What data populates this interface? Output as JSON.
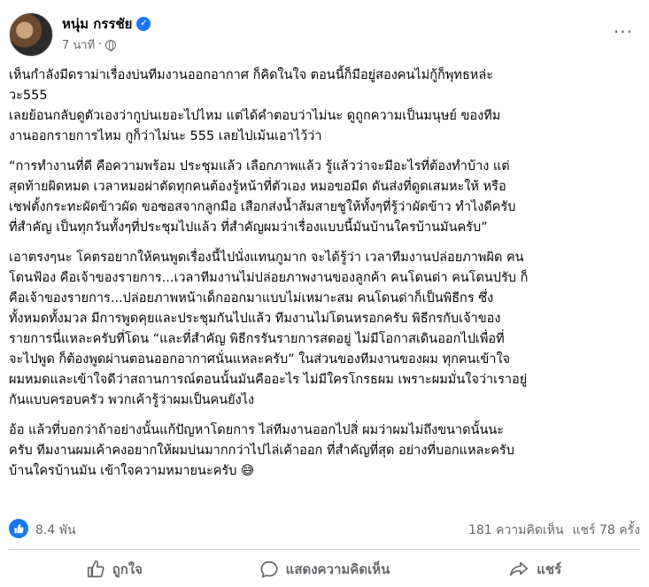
{
  "author": {
    "name": "หนุ่ม กรรชัย",
    "time": "7 นาที",
    "separator": "·"
  },
  "menu": {
    "more_label": "···"
  },
  "content": {
    "p1": [
      "เห็นกำลังมีดราม่าเรื่องบ่นทีมงานออกอากาศ ก็คิดในใจ ตอนนี้ก็มีอยู่สองคนไม่กู้ก็พุทธหล่ะ",
      "วะ555"
    ],
    "p2": [
      "เลยย้อนกลับดูตัวเองว่ากูบ่นเยอะไปไหม แต่ได้คำตอบว่าไม่นะ ดูถูกความเป็นมนุษย์ ของทีม",
      "งานออกรายการไหม กูก็ว่าไม่นะ 555 เลยไปเม้นเอาไว้ว่า"
    ],
    "p3": [
      "“การทำงานที่ดี คือความพร้อม ประชุมแล้ว เลือกภาพแล้ว รู้แล้วว่าจะมีอะไรที่ต้องทำบ้าง แต่",
      "สุดท้ายผิดหมด เวลาหมอผ่าตัดทุกคนต้องรู้หน้าที่ตัวเอง หมอขอมีด ดันส่งที่ดูดเสมหะให้ หรือ",
      "เชฟตั้งกระทะผัดข้าวผัด ขอซอสจากลูกมือ เสือกส่งน้ำส้มสายชูให้ทั้งๆที่รู้ว่าผัดข้าว ทำไงดีครับ",
      "ที่สำคัญ เป็นทุกวันทั้งๆที่ประชุมไปแล้ว ที่สำคัญผมว่าเรื่องแบบนี้มันบ้านใครบ้านมันครับ”"
    ],
    "p4": [
      "เอาตรงๆนะ โคตรอยากให้คนพูดเรื่องนี้ไปนั่งแทนกูมาก จะได้รู้ว่า เวลาทีมงานปล่อยภาพผิด คน",
      "โดนฟ้อง คือเจ้าของรายการ...เวลาทีมงานไม่ปล่อยภาพงานของลูกค้า คนโดนด่า คนโดนปรับ ก็",
      "คือเจ้าของรายการ...ปล่อยภาพหน้าเด็กออกมาแบบไม่เหมาะสม คนโดนด่าก็เป็นพิธีกร   ซึ่ง",
      "ทั้งหมดทั้งมวล มีการพูดคุยและประชุมกันไปแล้ว ทีมงานไม่โดนหรอกครับ พิธีกรกับเจ้าของ",
      "รายการนี่แหละครับที่โดน “และที่สำคัญ พิธีกรรันรายการสดอยู่ ไม่มีโอกาสเดินออกไปเพื่อที่",
      "จะไปพูด ก็ต้องพูดผ่านตอนออกอากาศนั่นแหละครับ” ในส่วนของทีมงานของผม ทุกคนเข้าใจ",
      "ผมหมดและเข้าใจดีว่าสถานการณ์ตอนนั้นมันคืออะไร ไม่มีใครโกรธผม เพราะผมมั่นใจว่าเราอยู่",
      "กันแบบครอบครัว พวกเค้ารู้ว่าผมเป็นคนยังไง"
    ],
    "p5": [
      "อ้อ  แล้วที่บอกว่าถ้าอย่างนั้นแก้ปัญหาโดยการ ไล่ทีมงานออกไปสิ่ ผมว่าผมไม่ถึงขนาดนั้นนะ",
      "ครับ ทีมงานผมเค้าคงอยากให้ผมบ่นมากกว่าไปไล่เค้าออก ที่สำคัญที่สุด อย่างที่บอกแหละครับ",
      "บ้านใครบ้านมัน เข้าใจความหมายนะครับ 😅"
    ]
  },
  "stats": {
    "likes": "8.4 พัน",
    "comments": "181 ความคิดเห็น",
    "shares": "แชร์ 78 ครั้ง"
  },
  "actions": {
    "like": "ถูกใจ",
    "comment": "แสดงความคิดเห็น",
    "share": "แชร์"
  },
  "colors": {
    "accent": "#1877f2",
    "muted_text": "#65676b",
    "text": "#050505",
    "divider": "#ced0d4"
  },
  "icons": [
    "verified-badge-icon",
    "globe-icon",
    "more-options-icon",
    "like-badge-icon",
    "thumbs-up-icon",
    "comment-icon",
    "share-icon"
  ]
}
